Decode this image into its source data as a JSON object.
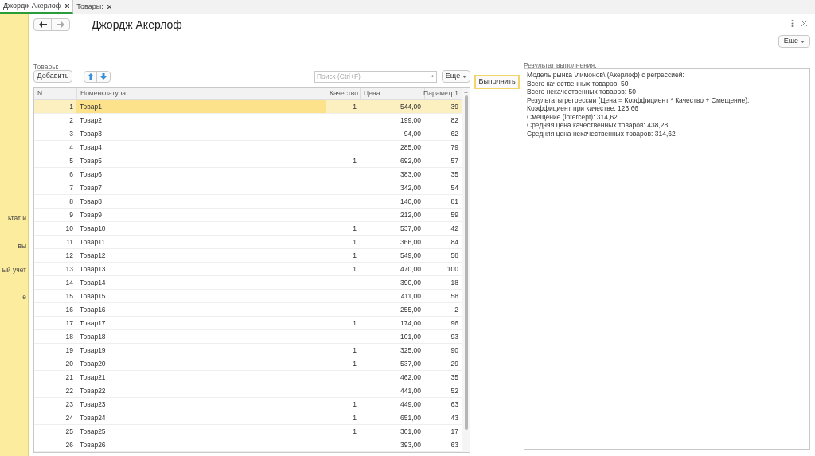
{
  "tabs": [
    {
      "label": "Джордж Акерлоф",
      "selected": true
    },
    {
      "label": "Товары:",
      "selected": false
    }
  ],
  "sidebar": {
    "items": [
      "ьтат и",
      "вы",
      "ый учет",
      "е"
    ]
  },
  "form": {
    "title": "Джордж Акерлоф",
    "more_button": "Еще"
  },
  "table_section": {
    "label": "Товары:",
    "add_button": "Добавить",
    "search": {
      "placeholder": "Поиск (Ctrl+F)"
    },
    "clear_button": "×",
    "more_button": "Еще"
  },
  "run_button": "Выполнить",
  "table": {
    "columns": [
      "N",
      "Номенклатура",
      "Качество",
      "Цена",
      "Параметр1"
    ],
    "rows": [
      {
        "cells": [
          "1",
          "Товар1",
          "1",
          "544,00",
          "39"
        ],
        "selected": true
      },
      {
        "cells": [
          "2",
          "Товар2",
          "",
          "199,00",
          "82"
        ],
        "selected": false
      },
      {
        "cells": [
          "3",
          "Товар3",
          "",
          "94,00",
          "62"
        ],
        "selected": false
      },
      {
        "cells": [
          "4",
          "Товар4",
          "",
          "285,00",
          "79"
        ],
        "selected": false
      },
      {
        "cells": [
          "5",
          "Товар5",
          "1",
          "692,00",
          "57"
        ],
        "selected": false
      },
      {
        "cells": [
          "6",
          "Товар6",
          "",
          "383,00",
          "35"
        ],
        "selected": false
      },
      {
        "cells": [
          "7",
          "Товар7",
          "",
          "342,00",
          "54"
        ],
        "selected": false
      },
      {
        "cells": [
          "8",
          "Товар8",
          "",
          "140,00",
          "81"
        ],
        "selected": false
      },
      {
        "cells": [
          "9",
          "Товар9",
          "",
          "212,00",
          "59"
        ],
        "selected": false
      },
      {
        "cells": [
          "10",
          "Товар10",
          "1",
          "537,00",
          "42"
        ],
        "selected": false
      },
      {
        "cells": [
          "11",
          "Товар11",
          "1",
          "366,00",
          "84"
        ],
        "selected": false
      },
      {
        "cells": [
          "12",
          "Товар12",
          "1",
          "549,00",
          "58"
        ],
        "selected": false
      },
      {
        "cells": [
          "13",
          "Товар13",
          "1",
          "470,00",
          "100"
        ],
        "selected": false
      },
      {
        "cells": [
          "14",
          "Товар14",
          "",
          "390,00",
          "18"
        ],
        "selected": false
      },
      {
        "cells": [
          "15",
          "Товар15",
          "",
          "411,00",
          "58"
        ],
        "selected": false
      },
      {
        "cells": [
          "16",
          "Товар16",
          "",
          "255,00",
          "2"
        ],
        "selected": false
      },
      {
        "cells": [
          "17",
          "Товар17",
          "1",
          "174,00",
          "96"
        ],
        "selected": false
      },
      {
        "cells": [
          "18",
          "Товар18",
          "",
          "101,00",
          "93"
        ],
        "selected": false
      },
      {
        "cells": [
          "19",
          "Товар19",
          "1",
          "325,00",
          "90"
        ],
        "selected": false
      },
      {
        "cells": [
          "20",
          "Товар20",
          "1",
          "537,00",
          "29"
        ],
        "selected": false
      },
      {
        "cells": [
          "21",
          "Товар21",
          "",
          "462,00",
          "35"
        ],
        "selected": false
      },
      {
        "cells": [
          "22",
          "Товар22",
          "",
          "441,00",
          "52"
        ],
        "selected": false
      },
      {
        "cells": [
          "23",
          "Товар23",
          "1",
          "449,00",
          "63"
        ],
        "selected": false
      },
      {
        "cells": [
          "24",
          "Товар24",
          "1",
          "651,00",
          "43"
        ],
        "selected": false
      },
      {
        "cells": [
          "25",
          "Товар25",
          "1",
          "301,00",
          "17"
        ],
        "selected": false
      },
      {
        "cells": [
          "26",
          "Товар26",
          "",
          "393,00",
          "63"
        ],
        "selected": false
      }
    ]
  },
  "result": {
    "label": "Результат выполнения:",
    "lines": [
      "Модель рынка \\лимонов\\ (Акерлоф) с регрессией:",
      "Всего качественных товаров: 50",
      "Всего некачественных товаров: 50",
      "Результаты регрессии (Цена = Коэффициент * Качество + Смещение):",
      "Коэффициент при качестве: 123,66",
      "Смещение (intercept): 314,62",
      "Средняя цена качественных товаров: 438,28",
      "Средняя цена некачественных товаров: 314,62"
    ]
  }
}
